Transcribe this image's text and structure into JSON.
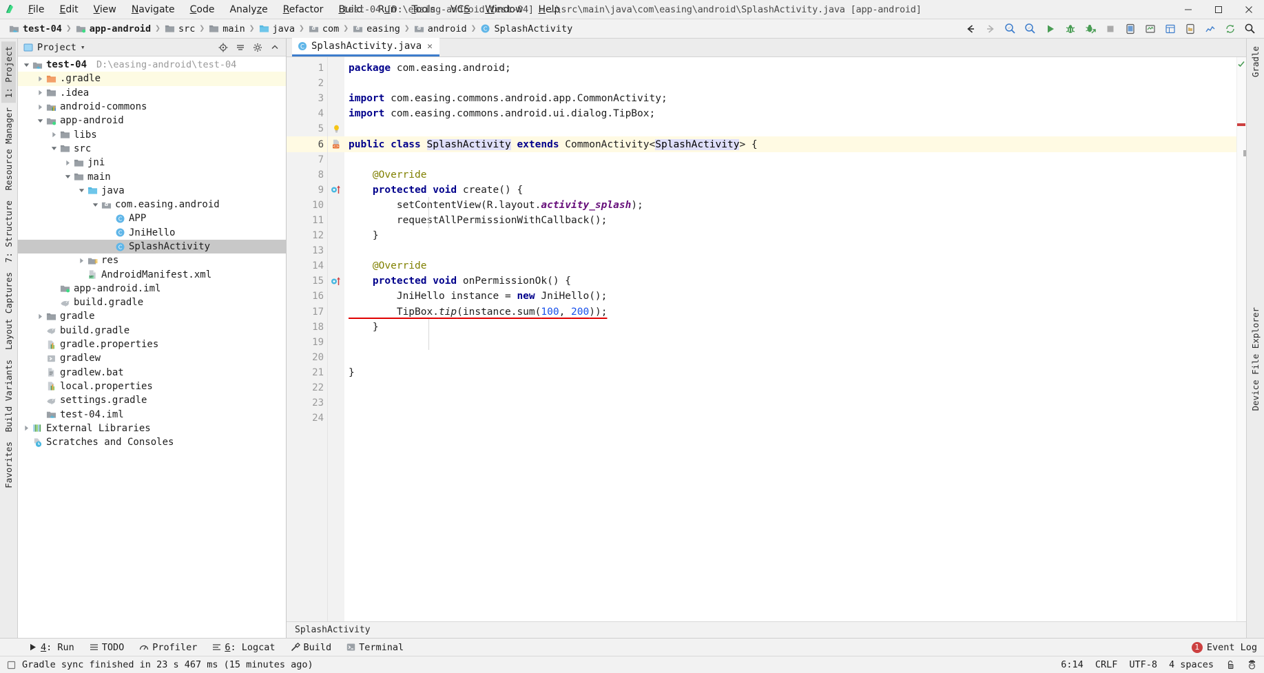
{
  "window": {
    "title": "test-04 [D:\\easing-android\\test-04] – …\\src\\main\\java\\com\\easing\\android\\SplashActivity.java [app-android]",
    "minimize": "—",
    "maximize": "▢",
    "close": "✕"
  },
  "menubar": {
    "items": [
      {
        "label": "File",
        "mnemonic": "F"
      },
      {
        "label": "Edit",
        "mnemonic": "E"
      },
      {
        "label": "View",
        "mnemonic": "V"
      },
      {
        "label": "Navigate",
        "mnemonic": "N"
      },
      {
        "label": "Code",
        "mnemonic": "C"
      },
      {
        "label": "Analyze",
        "mnemonic": "z"
      },
      {
        "label": "Refactor",
        "mnemonic": "R"
      },
      {
        "label": "Build",
        "mnemonic": "B"
      },
      {
        "label": "Run",
        "mnemonic": "u"
      },
      {
        "label": "Tools",
        "mnemonic": "T"
      },
      {
        "label": "VCS",
        "mnemonic": "S"
      },
      {
        "label": "Window",
        "mnemonic": "W"
      },
      {
        "label": "Help",
        "mnemonic": "H"
      }
    ]
  },
  "breadcrumb": {
    "separator": "❯",
    "items": [
      {
        "label": "test-04",
        "icon": "module-java-icon",
        "bold": true
      },
      {
        "label": "app-android",
        "icon": "module-android-icon",
        "bold": true
      },
      {
        "label": "src",
        "icon": "folder-icon",
        "bold": false
      },
      {
        "label": "main",
        "icon": "folder-icon",
        "bold": false
      },
      {
        "label": "java",
        "icon": "source-folder-icon",
        "bold": false
      },
      {
        "label": "com",
        "icon": "package-icon",
        "bold": false
      },
      {
        "label": "easing",
        "icon": "package-icon",
        "bold": false
      },
      {
        "label": "android",
        "icon": "package-icon",
        "bold": false
      },
      {
        "label": "SplashActivity",
        "icon": "java-class-icon",
        "bold": false
      }
    ]
  },
  "toolbar": {
    "buttons": [
      {
        "name": "back-icon",
        "title": "Back"
      },
      {
        "name": "forward-icon",
        "title": "Forward"
      },
      {
        "name": "search-everywhere-icon",
        "title": "Search Everywhere"
      },
      {
        "name": "find-in-path-icon",
        "title": "Find in Path"
      },
      {
        "name": "run-icon",
        "title": "Run 'app-android'"
      },
      {
        "name": "debug-icon",
        "title": "Debug 'app-android'"
      },
      {
        "name": "attach-debugger-icon",
        "title": "Attach Debugger to Android Process"
      },
      {
        "name": "stop-icon",
        "title": "Stop"
      },
      {
        "name": "avd-manager-icon",
        "title": "AVD Manager"
      },
      {
        "name": "sdk-manager-icon",
        "title": "SDK Manager"
      },
      {
        "name": "layout-inspector-icon",
        "title": "Layout Inspector"
      },
      {
        "name": "device-file-explorer-icon",
        "title": "Device File Explorer"
      },
      {
        "name": "profiler-icon",
        "title": "Profiler"
      },
      {
        "name": "sync-gradle-icon",
        "title": "Sync Project with Gradle Files"
      },
      {
        "name": "search-icon",
        "title": "Search"
      }
    ]
  },
  "left_strip": {
    "top": [
      {
        "label": "1: Project",
        "active": true,
        "name": "sidebar-tab-project"
      },
      {
        "label": "Resource Manager",
        "active": false,
        "name": "sidebar-tab-resource-manager"
      },
      {
        "label": "7: Structure",
        "active": false,
        "name": "sidebar-tab-structure"
      },
      {
        "label": "Layout Captures",
        "active": false,
        "name": "sidebar-tab-layout-captures"
      },
      {
        "label": "Build Variants",
        "active": false,
        "name": "sidebar-tab-build-variants"
      },
      {
        "label": "Favorites",
        "active": false,
        "name": "sidebar-tab-favorites"
      }
    ]
  },
  "right_strip": {
    "items": [
      {
        "label": "Gradle",
        "name": "sidebar-tab-gradle"
      },
      {
        "label": "Device File Explorer",
        "name": "sidebar-tab-device-file-explorer"
      }
    ]
  },
  "project_panel": {
    "title": "Project",
    "dropdown_caret": "▾",
    "actions": [
      {
        "name": "locate-icon",
        "title": "Select Opened File"
      },
      {
        "name": "collapse-all-icon",
        "title": "Collapse All"
      },
      {
        "name": "gear-icon",
        "title": "Settings"
      },
      {
        "name": "hide-icon",
        "title": "Hide"
      }
    ],
    "tree": [
      {
        "depth": 0,
        "arrow": "down",
        "icon": "module-java-icon",
        "label": "test-04",
        "bold": true,
        "path": "D:\\easing-android\\test-04",
        "state": "normal"
      },
      {
        "depth": 1,
        "arrow": "right",
        "icon": "folder-orange-icon",
        "label": ".gradle",
        "bold": false,
        "path": "",
        "state": "highlight"
      },
      {
        "depth": 1,
        "arrow": "right",
        "icon": "folder-icon",
        "label": ".idea",
        "bold": false,
        "path": "",
        "state": "normal"
      },
      {
        "depth": 1,
        "arrow": "right",
        "icon": "module-lib-icon",
        "label": "android-commons",
        "bold": false,
        "path": "",
        "state": "normal"
      },
      {
        "depth": 1,
        "arrow": "down",
        "icon": "module-android-icon",
        "label": "app-android",
        "bold": false,
        "path": "",
        "state": "normal"
      },
      {
        "depth": 2,
        "arrow": "right",
        "icon": "folder-icon",
        "label": "libs",
        "bold": false,
        "path": "",
        "state": "normal"
      },
      {
        "depth": 2,
        "arrow": "down",
        "icon": "folder-icon",
        "label": "src",
        "bold": false,
        "path": "",
        "state": "normal"
      },
      {
        "depth": 3,
        "arrow": "right",
        "icon": "folder-icon",
        "label": "jni",
        "bold": false,
        "path": "",
        "state": "normal"
      },
      {
        "depth": 3,
        "arrow": "down",
        "icon": "folder-icon",
        "label": "main",
        "bold": false,
        "path": "",
        "state": "normal"
      },
      {
        "depth": 4,
        "arrow": "down",
        "icon": "source-folder-icon",
        "label": "java",
        "bold": false,
        "path": "",
        "state": "normal"
      },
      {
        "depth": 5,
        "arrow": "down",
        "icon": "package-icon",
        "label": "com.easing.android",
        "bold": false,
        "path": "",
        "state": "normal"
      },
      {
        "depth": 6,
        "arrow": "none",
        "icon": "java-class-icon",
        "label": "APP",
        "bold": false,
        "path": "",
        "state": "normal"
      },
      {
        "depth": 6,
        "arrow": "none",
        "icon": "java-class-icon",
        "label": "JniHello",
        "bold": false,
        "path": "",
        "state": "normal"
      },
      {
        "depth": 6,
        "arrow": "none",
        "icon": "java-class-icon",
        "label": "SplashActivity",
        "bold": false,
        "path": "",
        "state": "selected"
      },
      {
        "depth": 4,
        "arrow": "right",
        "icon": "res-folder-icon",
        "label": "res",
        "bold": false,
        "path": "",
        "state": "normal"
      },
      {
        "depth": 4,
        "arrow": "none",
        "icon": "manifest-icon",
        "label": "AndroidManifest.xml",
        "bold": false,
        "path": "",
        "state": "normal"
      },
      {
        "depth": 2,
        "arrow": "none",
        "icon": "module-android-icon",
        "label": "app-android.iml",
        "bold": false,
        "path": "",
        "state": "normal"
      },
      {
        "depth": 2,
        "arrow": "none",
        "icon": "gradle-icon",
        "label": "build.gradle",
        "bold": false,
        "path": "",
        "state": "normal"
      },
      {
        "depth": 1,
        "arrow": "right",
        "icon": "folder-icon",
        "label": "gradle",
        "bold": false,
        "path": "",
        "state": "normal"
      },
      {
        "depth": 1,
        "arrow": "none",
        "icon": "gradle-icon",
        "label": "build.gradle",
        "bold": false,
        "path": "",
        "state": "normal"
      },
      {
        "depth": 1,
        "arrow": "none",
        "icon": "properties-icon",
        "label": "gradle.properties",
        "bold": false,
        "path": "",
        "state": "normal"
      },
      {
        "depth": 1,
        "arrow": "none",
        "icon": "script-icon",
        "label": "gradlew",
        "bold": false,
        "path": "",
        "state": "normal"
      },
      {
        "depth": 1,
        "arrow": "none",
        "icon": "text-file-icon",
        "label": "gradlew.bat",
        "bold": false,
        "path": "",
        "state": "normal"
      },
      {
        "depth": 1,
        "arrow": "none",
        "icon": "properties-icon",
        "label": "local.properties",
        "bold": false,
        "path": "",
        "state": "normal"
      },
      {
        "depth": 1,
        "arrow": "none",
        "icon": "gradle-icon",
        "label": "settings.gradle",
        "bold": false,
        "path": "",
        "state": "normal"
      },
      {
        "depth": 1,
        "arrow": "none",
        "icon": "module-java-icon",
        "label": "test-04.iml",
        "bold": false,
        "path": "",
        "state": "normal"
      },
      {
        "depth": 0,
        "arrow": "right",
        "icon": "libraries-icon",
        "label": "External Libraries",
        "bold": false,
        "path": "",
        "state": "normal"
      },
      {
        "depth": 0,
        "arrow": "none",
        "icon": "scratches-icon",
        "label": "Scratches and Consoles",
        "bold": false,
        "path": "",
        "state": "normal"
      }
    ]
  },
  "editor": {
    "tab": {
      "label": "SplashActivity.java",
      "icon": "java-class-icon",
      "close": "✕"
    },
    "breadcrumb_footer": "SplashActivity",
    "inspection_status": "ok",
    "lines": [
      {
        "n": 1,
        "marker": "none",
        "hl": false,
        "tokens": [
          {
            "t": "package ",
            "c": "kw"
          },
          {
            "t": "com.easing.android;",
            "c": "mth"
          }
        ]
      },
      {
        "n": 2,
        "marker": "none",
        "hl": false,
        "tokens": []
      },
      {
        "n": 3,
        "marker": "none",
        "hl": false,
        "tokens": [
          {
            "t": "import ",
            "c": "kw"
          },
          {
            "t": "com.easing.commons.android.app.CommonActivity;",
            "c": "mth"
          }
        ]
      },
      {
        "n": 4,
        "marker": "none",
        "hl": false,
        "tokens": [
          {
            "t": "import ",
            "c": "kw"
          },
          {
            "t": "com.easing.commons.android.ui.dialog.TipBox;",
            "c": "mth"
          }
        ]
      },
      {
        "n": 5,
        "marker": "bulb",
        "hl": false,
        "tokens": []
      },
      {
        "n": 6,
        "marker": "class",
        "hl": true,
        "tokens": [
          {
            "t": "public class ",
            "c": "kw"
          },
          {
            "t": "SplashActivity",
            "c": "ident-hl"
          },
          {
            "t": " ",
            "c": "mth"
          },
          {
            "t": "extends ",
            "c": "kw"
          },
          {
            "t": "CommonActivity<",
            "c": "mth"
          },
          {
            "t": "SplashActivity",
            "c": "ident-hl"
          },
          {
            "t": "> {",
            "c": "mth"
          }
        ]
      },
      {
        "n": 7,
        "marker": "none",
        "hl": false,
        "tokens": []
      },
      {
        "n": 8,
        "marker": "none",
        "hl": false,
        "tokens": [
          {
            "t": "    @Override",
            "c": "anno"
          }
        ]
      },
      {
        "n": 9,
        "marker": "override",
        "hl": false,
        "tokens": [
          {
            "t": "    ",
            "c": "mth"
          },
          {
            "t": "protected void ",
            "c": "kw"
          },
          {
            "t": "create() {",
            "c": "mth"
          }
        ]
      },
      {
        "n": 10,
        "marker": "none",
        "hl": false,
        "tokens": [
          {
            "t": "        setContentView(R.layout.",
            "c": "mth"
          },
          {
            "t": "activity_splash",
            "c": "fld"
          },
          {
            "t": ");",
            "c": "mth"
          }
        ]
      },
      {
        "n": 11,
        "marker": "none",
        "hl": false,
        "tokens": [
          {
            "t": "        requestAllPermissionWithCallback();",
            "c": "mth"
          }
        ]
      },
      {
        "n": 12,
        "marker": "none",
        "hl": false,
        "tokens": [
          {
            "t": "    }",
            "c": "mth"
          }
        ]
      },
      {
        "n": 13,
        "marker": "none",
        "hl": false,
        "tokens": []
      },
      {
        "n": 14,
        "marker": "none",
        "hl": false,
        "tokens": [
          {
            "t": "    @Override",
            "c": "anno"
          }
        ]
      },
      {
        "n": 15,
        "marker": "override",
        "hl": false,
        "tokens": [
          {
            "t": "    ",
            "c": "mth"
          },
          {
            "t": "protected void ",
            "c": "kw"
          },
          {
            "t": "onPermissionOk() {",
            "c": "mth"
          }
        ]
      },
      {
        "n": 16,
        "marker": "none",
        "hl": false,
        "tokens": [
          {
            "t": "        JniHello instance = ",
            "c": "mth"
          },
          {
            "t": "new ",
            "c": "kw"
          },
          {
            "t": "JniHello();",
            "c": "mth"
          }
        ]
      },
      {
        "n": 17,
        "marker": "none",
        "hl": false,
        "underline": true,
        "tokens": [
          {
            "t": "        TipBox.",
            "c": "mth"
          },
          {
            "t": "tip",
            "c": "fld-it"
          },
          {
            "t": "(instance.sum(",
            "c": "mth"
          },
          {
            "t": "100",
            "c": "num"
          },
          {
            "t": ", ",
            "c": "mth"
          },
          {
            "t": "200",
            "c": "num"
          },
          {
            "t": "));",
            "c": "mth"
          }
        ]
      },
      {
        "n": 18,
        "marker": "none",
        "hl": false,
        "tokens": [
          {
            "t": "    }",
            "c": "mth"
          }
        ]
      },
      {
        "n": 19,
        "marker": "none",
        "hl": false,
        "tokens": []
      },
      {
        "n": 20,
        "marker": "none",
        "hl": false,
        "tokens": []
      },
      {
        "n": 21,
        "marker": "none",
        "hl": false,
        "tokens": [
          {
            "t": "}",
            "c": "mth"
          }
        ]
      },
      {
        "n": 22,
        "marker": "none",
        "hl": false,
        "tokens": []
      },
      {
        "n": 23,
        "marker": "none",
        "hl": false,
        "tokens": []
      },
      {
        "n": 24,
        "marker": "none",
        "hl": false,
        "tokens": []
      }
    ]
  },
  "toolwindows": {
    "items": [
      {
        "label": "4: Run",
        "mnemonic": "4",
        "icon": "run-small-icon",
        "name": "toolwindow-run"
      },
      {
        "label": "TODO",
        "mnemonic": "",
        "icon": "todo-icon",
        "name": "toolwindow-todo"
      },
      {
        "label": "Profiler",
        "mnemonic": "",
        "icon": "profiler-small-icon",
        "name": "toolwindow-profiler"
      },
      {
        "label": "6: Logcat",
        "mnemonic": "6",
        "icon": "logcat-icon",
        "name": "toolwindow-logcat"
      },
      {
        "label": "Build",
        "mnemonic": "",
        "icon": "build-hammer-icon",
        "name": "toolwindow-build"
      },
      {
        "label": "Terminal",
        "mnemonic": "",
        "icon": "terminal-icon",
        "name": "toolwindow-terminal"
      }
    ],
    "event_log": {
      "label": "Event Log",
      "badge": "1"
    }
  },
  "statusbar": {
    "message": "Gradle sync finished in 23 s 467 ms (15 minutes ago)",
    "caret_position": "6:14",
    "line_separator": "CRLF",
    "encoding": "UTF-8",
    "indent": "4 spaces",
    "lock_icon": "unlocked-icon",
    "inspector_icon": "hector-icon"
  },
  "colors": {
    "accent_blue": "#3d7dcc",
    "selection_gray": "#c8c8c8",
    "highlight_yellow": "#fffae3",
    "error_red": "#e00000",
    "keyword_blue": "#00008b",
    "number_blue": "#1750eb",
    "field_purple": "#660e7a",
    "annotation_olive": "#808000",
    "green_run": "#499c54",
    "badge_red": "#cc4040"
  }
}
